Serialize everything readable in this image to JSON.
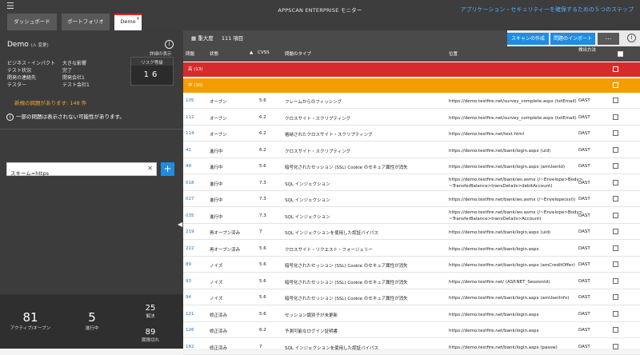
{
  "topbar": {
    "menu_icon": "hamburger-icon",
    "app_title": "APPSCAN ENTERPRISE モニター",
    "help_link": "アプリケーション・セキュリティーを確保するための５つのステップ",
    "tabs": [
      {
        "label": "ダッシュボード"
      },
      {
        "label": "ポートフォリオ"
      },
      {
        "label": "Demo",
        "close": "×"
      }
    ]
  },
  "left": {
    "title": "Demo",
    "title_sub": "(⚠ 変更)",
    "details_link": "詳細の表示",
    "fields": [
      {
        "key": "ビジネス・インパクト",
        "value": "大きな影響"
      },
      {
        "key": "テスト状況",
        "value": "完了"
      },
      {
        "key": "開発の連絡先",
        "value": "開発会社1"
      },
      {
        "key": "テスター",
        "value": "テスト会社1"
      }
    ],
    "risk_label": "リスク等級",
    "risk_value": "16",
    "warning": "新規の問題があります: 148 件",
    "note": "一部の問題は表示されない可能性があります。",
    "filter_value": "スキーム=https",
    "stats": [
      {
        "num": "81",
        "label": "アクティブ/オープン"
      },
      {
        "num": "5",
        "label": "進行中"
      },
      {
        "num": "25",
        "label": "解決"
      },
      {
        "num": "89",
        "label": "期限切れ"
      }
    ]
  },
  "main": {
    "group_label": "重大度",
    "count_label": "111 項目",
    "buttons": {
      "create_scan": "スキャンの作成",
      "import": "問題のインポート",
      "more": "..."
    },
    "columns": {
      "id": "問題",
      "status": "状態",
      "cvss": "CVSS",
      "type": "問題のタイプ",
      "location": "位置",
      "method": "検出方法"
    },
    "groups": [
      {
        "label": "高 (13)",
        "color": "#d62b2b"
      },
      {
        "label": "中 (30)",
        "color": "#f59c00"
      }
    ],
    "rows": [
      {
        "id": "105",
        "status": "オープン",
        "cvss": "5.6",
        "type": "フレームからのフィッシング",
        "loc1": "https://demo.testfire.net/survey_complete.aspx (txtEmail)",
        "loc2": "",
        "method": "DAST"
      },
      {
        "id": "112",
        "status": "オープン",
        "cvss": "6.2",
        "type": "クロスサイト・スクリプティング",
        "loc1": "https://demo.testfire.net/survey_complete.aspx (txtEmail)",
        "loc2": "",
        "method": "DAST"
      },
      {
        "id": "114",
        "status": "オープン",
        "cvss": "6.2",
        "type": "格納されたクロスサイト・スクリプティング",
        "loc1": "https://demo.testfire.net/test.html",
        "loc2": "",
        "method": "DAST"
      },
      {
        "id": "41",
        "status": "進行中",
        "cvss": "6.2",
        "type": "クロスサイト・スクリプティング",
        "loc1": "https://demo.testfire.net/bank/login.aspx (uid)",
        "loc2": "",
        "method": "DAST"
      },
      {
        "id": "49",
        "status": "進行中",
        "cvss": "5.6",
        "type": "暗号化されたセッション (SSL) Cookie のセキュア属性が消失",
        "loc1": "https://demo.testfire.net/bank/login.aspx (amUserId)",
        "loc2": "",
        "method": "DAST"
      },
      {
        "id": "018",
        "status": "進行中",
        "cvss": "7.3",
        "type": "SQL インジェクション",
        "loc1": "https://demo.testfire.net/bank/ws.asmx (/~Envelope>Body>",
        "loc2": "~TransferBalance>transDetails>debitAccount)",
        "method": "DAST"
      },
      {
        "id": "027",
        "status": "進行中",
        "cvss": "7.3",
        "type": "SQL インジェクション",
        "loc1": "https://demo.testfire.net/bank/ws.asmx (/~Envelope(xsl))",
        "loc2": "",
        "method": "DAST"
      },
      {
        "id": "035",
        "status": "進行中",
        "cvss": "7.3",
        "type": "SQL インジェクション",
        "loc1": "https://demo.testfire.net/bank/ws.asmx (/~Envelope>Body>",
        "loc2": "~TransferBalance>transDetails>Account)",
        "method": "DAST"
      },
      {
        "id": "219",
        "status": "再オープン済み",
        "cvss": "7",
        "type": "SQL インジェクションを使用した認証バイパス",
        "loc1": "https://demo.testfire.net/bank/login.aspx (uid)",
        "loc2": "",
        "method": "DAST"
      },
      {
        "id": "222",
        "status": "再オープン済み",
        "cvss": "5.6",
        "type": "クロスサイト・リクエスト・フォージェリー",
        "loc1": "https://demo.testfire.net/bank/login.aspx",
        "loc2": "",
        "method": "DAST"
      },
      {
        "id": "89",
        "status": "ノイズ",
        "cvss": "5.6",
        "type": "暗号化されたセッション (SSL) Cookie のセキュア属性が消失",
        "loc1": "https://demo.testfire.net/bank/login.aspx (amCreditOffer)",
        "loc2": "",
        "method": "DAST"
      },
      {
        "id": "93",
        "status": "ノイズ",
        "cvss": "5.6",
        "type": "暗号化されたセッション (SSL) Cookie のセキュア属性が消失",
        "loc1": "https://demo.testfire.net/ (ASP.NET_SessionId)",
        "loc2": "",
        "method": "DAST"
      },
      {
        "id": "94",
        "status": "ノイズ",
        "cvss": "5.6",
        "type": "暗号化されたセッション (SSL) Cookie のセキュア属性が消失",
        "loc1": "https://demo.testfire.net/bank/login.aspx (amUserInfo)",
        "loc2": "",
        "method": "DAST"
      },
      {
        "id": "121",
        "status": "修正済み",
        "cvss": "5.6",
        "type": "セッション識別子が未更新",
        "loc1": "https://demo.testfire.net/bank/login.aspx",
        "loc2": "",
        "method": "DAST"
      },
      {
        "id": "126",
        "status": "修正済み",
        "cvss": "6.2",
        "type": "予測可能なログイン証明書",
        "loc1": "https://demo.testfire.net/bank/login.aspx",
        "loc2": "",
        "method": "DAST"
      },
      {
        "id": "182",
        "status": "修正済み",
        "cvss": "7",
        "type": "SQL インジェクションを使用した認証バイパス",
        "loc1": "https://demo.testfire.net/bank/login.aspx (passw)",
        "loc2": "",
        "method": "DAST"
      }
    ]
  }
}
